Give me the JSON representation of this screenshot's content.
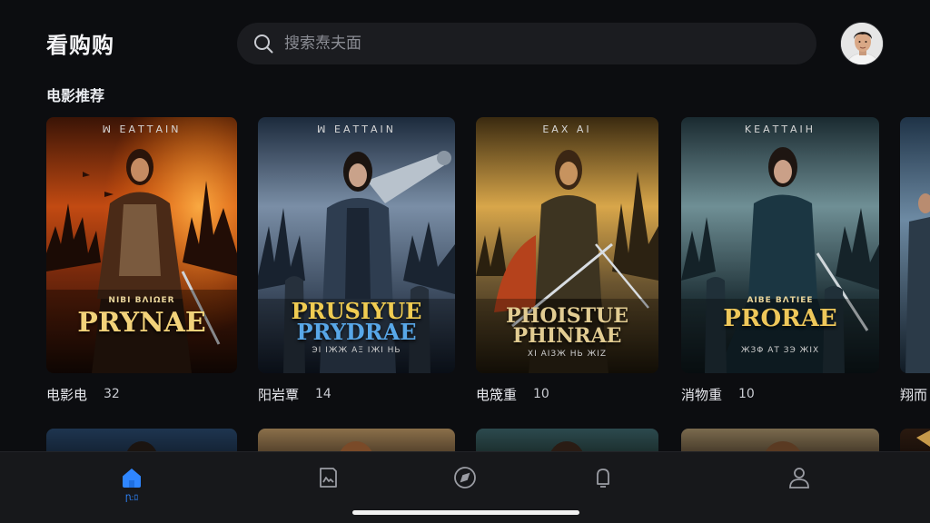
{
  "app": {
    "title": "看购购"
  },
  "search": {
    "placeholder": "搜索焘夫面"
  },
  "section": {
    "title": "电影推荐"
  },
  "movies": [
    {
      "label": "电影电",
      "count": "32",
      "poster_top": "ꟽ ΕΑΤΤΑΙΝ",
      "poster_sub": "ΝIΒΙ ΒΛΙΩΕR",
      "poster_title_1": "PRYNAE",
      "poster_title_2": "",
      "poster_bottom": ""
    },
    {
      "label": "阳岩覃",
      "count": "14",
      "poster_top": "ꟽ ΕΑΤΤΑΙΝ",
      "poster_sub": "",
      "poster_title_1": "PRUSIYUE",
      "poster_title_2": "PRYDRAE",
      "poster_bottom": "ЭI ΙЖЖ ΑΞ ΙЖΙ ΗЬ"
    },
    {
      "label": "电筬重",
      "count": "10",
      "poster_top": "ΕΑΧ ΑΙ",
      "poster_sub": "",
      "poster_title_1": "PHOISTUE",
      "poster_title_2": "PHINRAE",
      "poster_bottom": "ΧΙ ΑΙЗЖ ΗЬ ЖΙΖ"
    },
    {
      "label": "消物重",
      "count": "10",
      "poster_top": "ΚΕΑΤΤΑΙΗ",
      "poster_sub": "ΑΙΒΕ ΒΛΤΙΕΕ",
      "poster_title_1": "PRORAE",
      "poster_title_2": "",
      "poster_bottom": "ЖЗΦ ΑΤ ЗЭ ЖΙΧ"
    },
    {
      "label": "翔而",
      "count": "",
      "poster_top": "",
      "poster_sub": "",
      "poster_title_1": "",
      "poster_title_2": "",
      "poster_bottom": ""
    }
  ],
  "tabbar": {
    "items": [
      {
        "icon": "home-icon",
        "label": "Ꞃ:ﾛ",
        "active": true
      },
      {
        "icon": "media-icon",
        "label": "",
        "active": false
      },
      {
        "icon": "compass-icon",
        "label": "",
        "active": false
      },
      {
        "icon": "bell-icon",
        "label": "",
        "active": false
      },
      {
        "icon": "profile-icon",
        "label": "",
        "active": false
      }
    ]
  },
  "colors": {
    "accent": "#2f86ff",
    "background": "#0c0d10",
    "tabbar": "#17181b",
    "search": "#1b1c20"
  }
}
